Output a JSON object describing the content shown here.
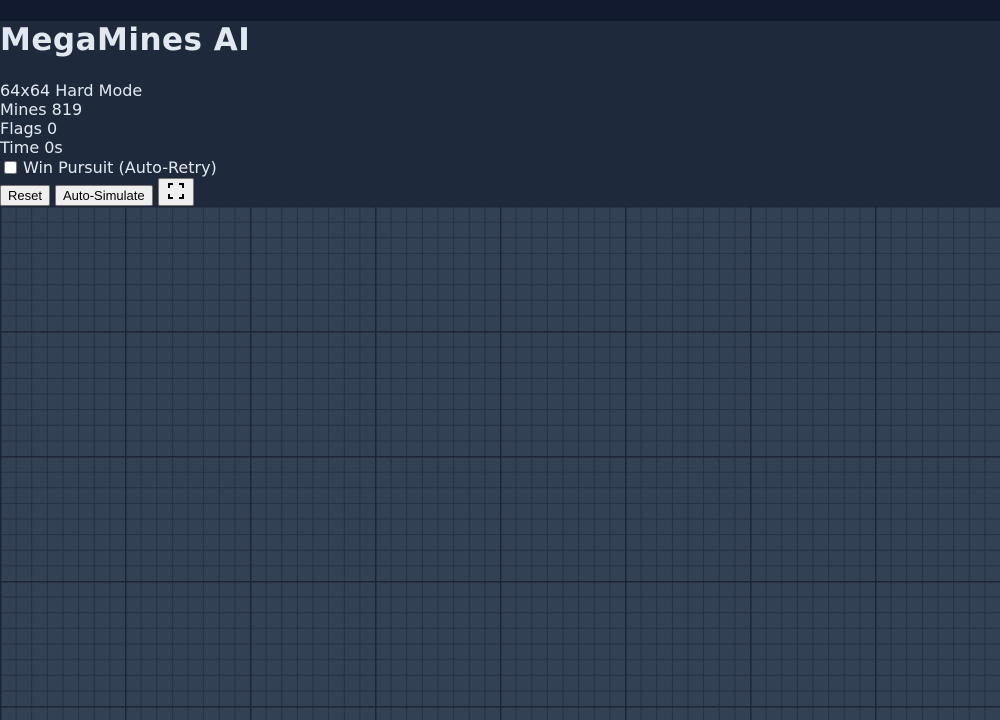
{
  "app": {
    "title": "MegaMines AI"
  },
  "stats": {
    "mode": "64x64 Hard Mode",
    "mines": "Mines 819",
    "flags": "Flags 0",
    "time": "Time 0s"
  },
  "options": {
    "win_pursuit_label": "Win Pursuit (Auto-Retry)",
    "win_pursuit_checked": false
  },
  "controls": {
    "reset_label": "Reset",
    "auto_simulate_label": "Auto-Simulate",
    "fullscreen_icon": "fullscreen-icon"
  },
  "board": {
    "columns": 64,
    "rows": 64,
    "cell_state": "unrevealed",
    "colors": {
      "cell": "#334155",
      "grid_line": "#243043",
      "block_line": "#1c2638",
      "background": "#1e293b"
    }
  }
}
